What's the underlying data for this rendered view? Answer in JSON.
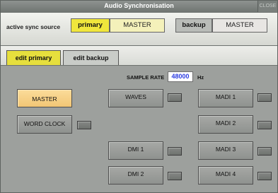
{
  "window": {
    "title": "Audio Synchronisation",
    "close_label": "CLOSE"
  },
  "sync": {
    "label": "active sync source",
    "primary_label": "primary",
    "primary_value": "MASTER",
    "backup_label": "backup",
    "backup_value": "MASTER"
  },
  "tabs": [
    {
      "label": "edit primary",
      "active": true
    },
    {
      "label": "edit backup",
      "active": false
    }
  ],
  "sample_rate": {
    "label": "SAMPLE RATE",
    "value": "48000",
    "unit": "Hz"
  },
  "sources": {
    "master": "MASTER",
    "word_clock": "WORD CLOCK",
    "waves": "WAVES",
    "dmi_1": "DMI 1",
    "dmi_2": "DMI 2",
    "madi_1": "MADI 1",
    "madi_2": "MADI 2",
    "madi_3": "MADI 3",
    "madi_4": "MADI 4",
    "selected": "MASTER"
  },
  "colors": {
    "selected_source": "#f2c675",
    "primary_accent": "#f0e63c",
    "sample_rate_text": "#2a3be0"
  }
}
